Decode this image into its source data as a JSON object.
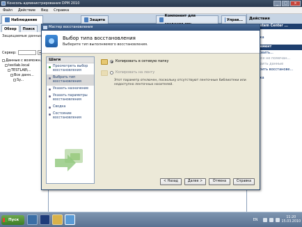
{
  "window": {
    "title": "Консоль администрирования DPM 2010"
  },
  "menu": [
    "Файл",
    "Действие",
    "Вид",
    "Справка"
  ],
  "tabs": [
    "Наблюдение",
    "Защита",
    "Компонент для создания отч...",
    "Управ..."
  ],
  "left_pane": {
    "tabs": [
      "Обзор",
      "Поиск"
    ],
    "subtitle": "Защищаемые данные",
    "filter_label": "Сервер:",
    "tree": [
      "Данные с возможн...",
      "testlab.local",
      "TESTLAB\\...",
      "Все данн...",
      "Sy..."
    ]
  },
  "actions_pane": {
    "title": "Действия",
    "section1": "uit System Center ...",
    "items1": [
      "ить",
      "правка"
    ],
    "section2": "ый элемент",
    "items2": [
      "становить...",
      "ить все не помечан...",
      "роверить данные",
      "астроить восстанове..."
    ],
    "items3": [
      "правка"
    ]
  },
  "dialog": {
    "title": "Мастер восстановления",
    "header_title": "Выбор типа восстановления",
    "header_subtitle": "Выберите тип выполняемого восстановления.",
    "steps_title": "Шаги",
    "steps": [
      {
        "label": "Просмотреть выбор восстановления",
        "state": "done"
      },
      {
        "label": "Выбрать тип восстановления",
        "state": "current"
      },
      {
        "label": "Указать назначение",
        "state": "pending"
      },
      {
        "label": "Указать параметры восстановления",
        "state": "pending"
      },
      {
        "label": "Сводка",
        "state": "pending"
      },
      {
        "label": "Состояние восстановления",
        "state": "pending"
      }
    ],
    "options": [
      {
        "label": "Копировать в сетевую папку",
        "selected": true,
        "enabled": true
      },
      {
        "label": "Копировать на ленту",
        "selected": false,
        "enabled": false
      }
    ],
    "tape_note": "Этот параметр отключен, поскольку отсутствуют ленточные библиотеки или недоступно ленточных носителей.",
    "buttons": {
      "back": "< Назад",
      "next": "Далее >",
      "cancel": "Отмена",
      "help": "Справка"
    }
  },
  "taskbar": {
    "start": "Пуск",
    "lang": "EN",
    "time": "11:20",
    "date": "15.03.2010"
  }
}
